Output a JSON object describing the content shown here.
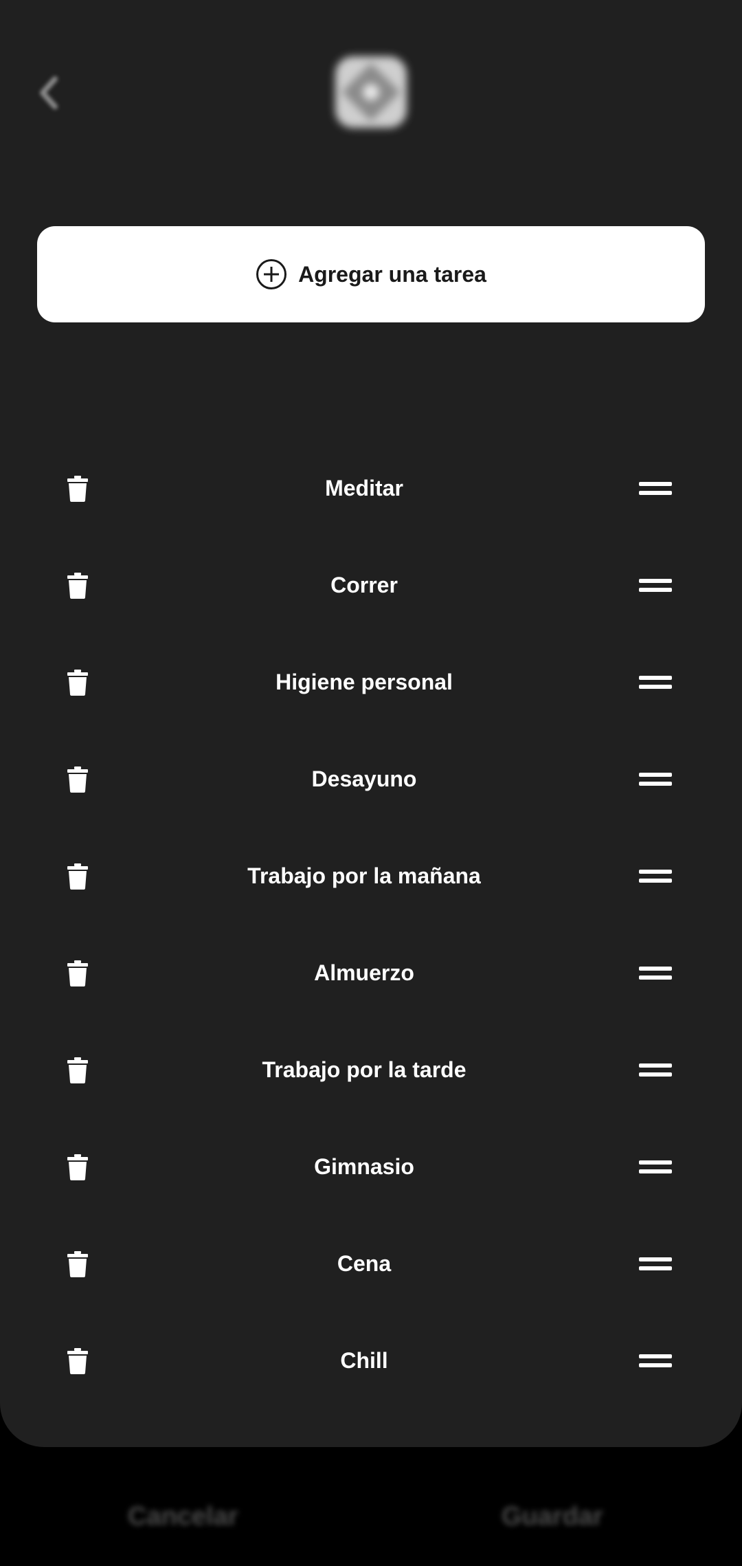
{
  "header": {
    "back_icon": "chevron-left-icon",
    "logo_icon": "app-logo-icon"
  },
  "add_task": {
    "icon": "plus-circle-icon",
    "label": "Agregar una tarea"
  },
  "tasks": [
    {
      "label": "Meditar"
    },
    {
      "label": "Correr"
    },
    {
      "label": "Higiene personal"
    },
    {
      "label": "Desayuno"
    },
    {
      "label": "Trabajo por la mañana"
    },
    {
      "label": "Almuerzo"
    },
    {
      "label": "Trabajo por la tarde"
    },
    {
      "label": "Gimnasio"
    },
    {
      "label": "Cena"
    },
    {
      "label": "Chill"
    }
  ],
  "row_icons": {
    "delete": "trash-icon",
    "drag": "drag-handle-icon"
  },
  "footer": {
    "cancel_label": "Cancelar",
    "save_label": "Guardar"
  },
  "colors": {
    "panel_background": "#202020",
    "screen_background": "#000000",
    "add_button_background": "#ffffff",
    "text_primary": "#ffffff"
  }
}
